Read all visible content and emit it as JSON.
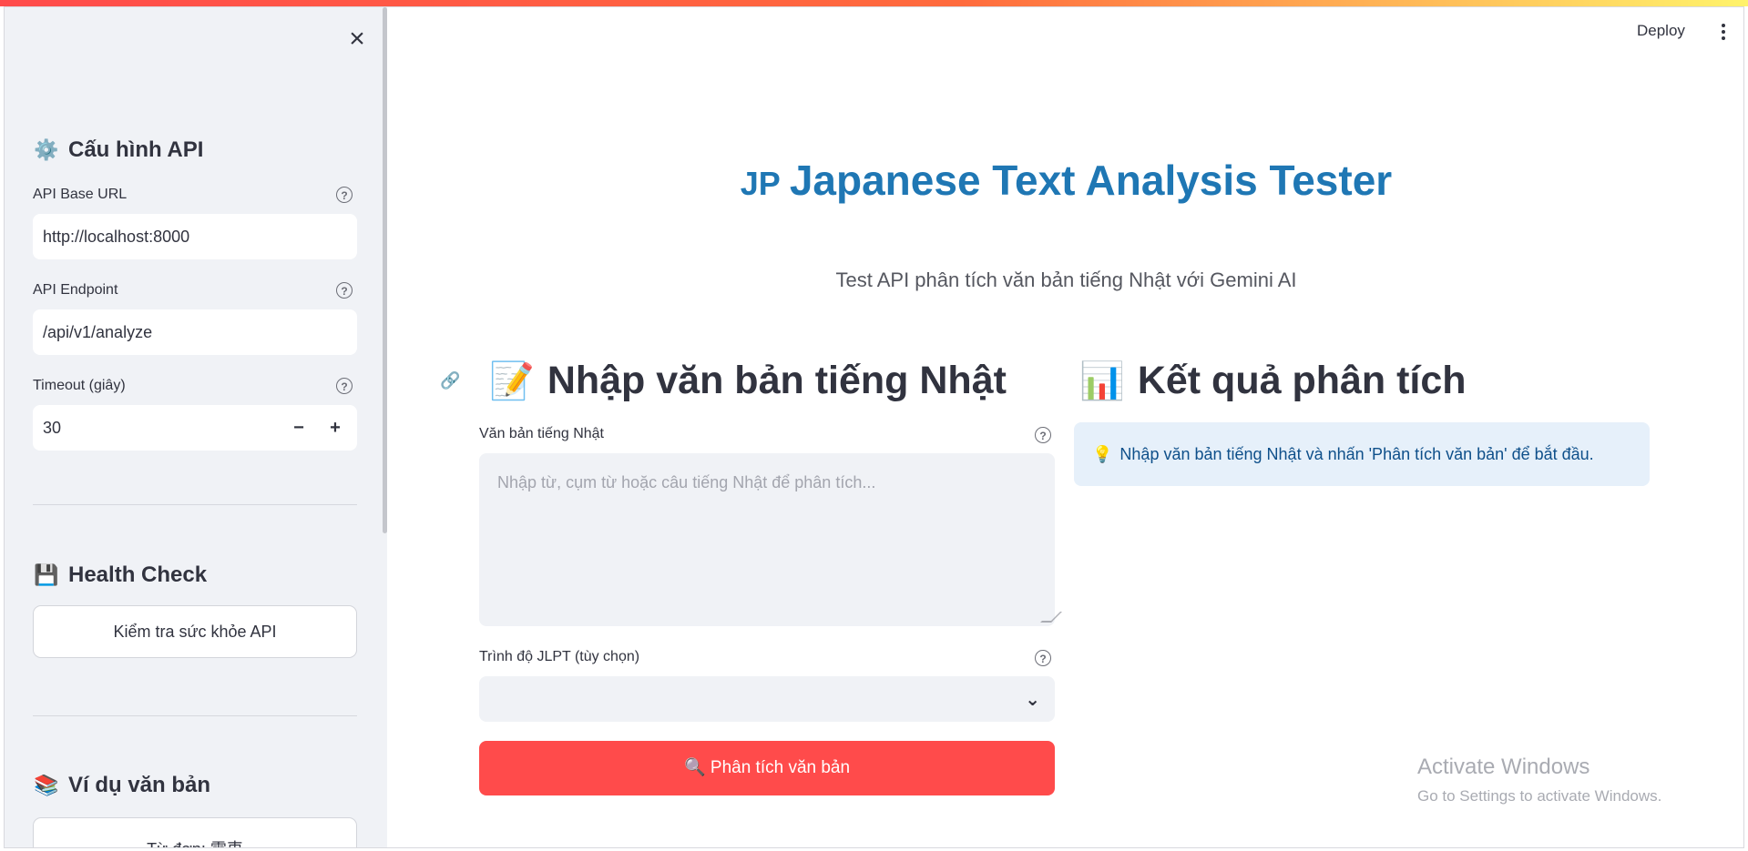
{
  "sidebar": {
    "close_icon": "×",
    "config_section": {
      "emoji": "⚙️",
      "title": "Cấu hình API"
    },
    "api_base_url": {
      "label": "API Base URL",
      "value": "http://localhost:8000"
    },
    "api_endpoint": {
      "label": "API Endpoint",
      "value": "/api/v1/analyze"
    },
    "timeout": {
      "label": "Timeout (giây)",
      "value": "30",
      "minus": "−",
      "plus": "+"
    },
    "health_section": {
      "emoji": "💾",
      "title": "Health Check"
    },
    "health_button": "Kiểm tra sức khỏe API",
    "examples_section": {
      "emoji": "📚",
      "title": "Ví dụ văn bản"
    },
    "example_button_partial": "Từ đơn: 電車"
  },
  "header": {
    "deploy_label": "Deploy",
    "menu_icon": "more-vertical-icon"
  },
  "main": {
    "title_prefix": "JP",
    "title": "Japanese Text Analysis Tester",
    "subtitle": "Test API phân tích văn bản tiếng Nhật với Gemini AI",
    "input_section": {
      "emoji": "📝",
      "title": "Nhập văn bản tiếng Nhật"
    },
    "text_label": "Văn bản tiếng Nhật",
    "text_placeholder": "Nhập từ, cụm từ hoặc câu tiếng Nhật để phân tích...",
    "jlpt_label": "Trình độ JLPT (tùy chọn)",
    "jlpt_value": "",
    "analyze_button": {
      "emoji": "🔍",
      "label": "Phân tích văn bản"
    },
    "result_section": {
      "emoji": "📊",
      "title": "Kết quả phân tích"
    },
    "info_message": {
      "emoji": "💡",
      "text": "Nhập văn bản tiếng Nhật và nhấn 'Phân tích văn bản' để bắt đầu."
    }
  },
  "os_watermark": {
    "line1": "Activate Windows",
    "line2": "Go to Settings to activate Windows."
  },
  "colors": {
    "accent": "#ff4b4b",
    "title_blue": "#1f77b4",
    "sidebar_bg": "#f0f2f6",
    "info_bg": "#e6f0fa"
  }
}
